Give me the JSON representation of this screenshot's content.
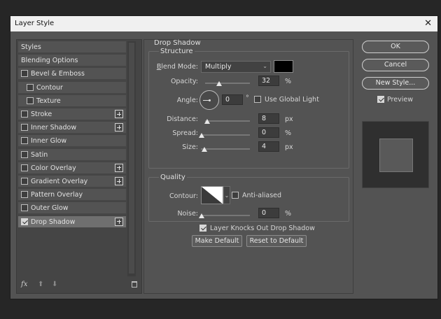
{
  "window": {
    "title": "Layer Style",
    "close_glyph": "✕"
  },
  "styles": [
    {
      "label": "Styles",
      "checkbox": null,
      "plus": false,
      "indent": false,
      "selected": false
    },
    {
      "label": "Blending Options",
      "checkbox": null,
      "plus": false,
      "indent": false,
      "selected": false
    },
    {
      "label": "Bevel & Emboss",
      "checkbox": false,
      "plus": false,
      "indent": false,
      "selected": false
    },
    {
      "label": "Contour",
      "checkbox": false,
      "plus": false,
      "indent": true,
      "selected": false
    },
    {
      "label": "Texture",
      "checkbox": false,
      "plus": false,
      "indent": true,
      "selected": false
    },
    {
      "label": "Stroke",
      "checkbox": false,
      "plus": true,
      "indent": false,
      "selected": false
    },
    {
      "label": "Inner Shadow",
      "checkbox": false,
      "plus": true,
      "indent": false,
      "selected": false
    },
    {
      "label": "Inner Glow",
      "checkbox": false,
      "plus": false,
      "indent": false,
      "selected": false
    },
    {
      "label": "Satin",
      "checkbox": false,
      "plus": false,
      "indent": false,
      "selected": false
    },
    {
      "label": "Color Overlay",
      "checkbox": false,
      "plus": true,
      "indent": false,
      "selected": false
    },
    {
      "label": "Gradient Overlay",
      "checkbox": false,
      "plus": true,
      "indent": false,
      "selected": false
    },
    {
      "label": "Pattern Overlay",
      "checkbox": false,
      "plus": false,
      "indent": false,
      "selected": false
    },
    {
      "label": "Outer Glow",
      "checkbox": false,
      "plus": false,
      "indent": false,
      "selected": false
    },
    {
      "label": "Drop Shadow",
      "checkbox": true,
      "plus": true,
      "indent": false,
      "selected": true
    }
  ],
  "footer": {
    "fx_label": "fx",
    "up_glyph": "⬆",
    "down_glyph": "⬇"
  },
  "drop_shadow": {
    "heading": "Drop Shadow",
    "structure": {
      "title": "Structure",
      "blend_mode_label": "Blend Mode:",
      "blend_mode_value": "Multiply",
      "shadow_color": "#000000",
      "opacity_label": "Opacity:",
      "opacity_value": "32",
      "opacity_unit": "%",
      "opacity_fraction": 0.32,
      "angle_label": "Angle:",
      "angle_value": "0",
      "angle_unit": "°",
      "global_light_label": "Use Global Light",
      "global_light_checked": false,
      "distance_label": "Distance:",
      "distance_value": "8",
      "distance_unit": "px",
      "spread_label": "Spread:",
      "spread_value": "0",
      "spread_unit": "%",
      "size_label": "Size:",
      "size_value": "4",
      "size_unit": "px"
    },
    "quality": {
      "title": "Quality",
      "contour_label": "Contour:",
      "anti_aliased_label": "Anti-aliased",
      "anti_aliased_checked": false,
      "noise_label": "Noise:",
      "noise_value": "0",
      "noise_unit": "%"
    },
    "knocks_out_label": "Layer Knocks Out Drop Shadow",
    "knocks_out_checked": true,
    "make_default_label": "Make Default",
    "reset_default_label": "Reset to Default"
  },
  "actions": {
    "ok_label": "OK",
    "cancel_label": "Cancel",
    "new_style_label": "New Style...",
    "preview_label": "Preview",
    "preview_checked": true
  }
}
